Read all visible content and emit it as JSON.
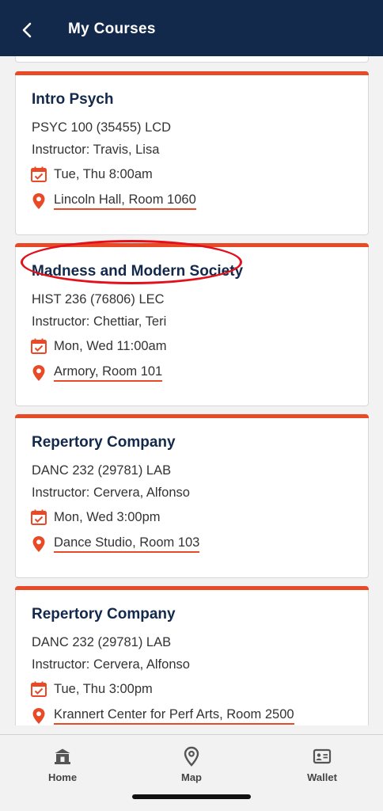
{
  "header": {
    "title": "My Courses"
  },
  "courses": [
    {
      "title": "Intro Psych",
      "code": "PSYC 100 (35455) LCD",
      "instructor": "Instructor: Travis, Lisa",
      "time": "Tue, Thu 8:00am",
      "location": "Lincoln Hall, Room 1060"
    },
    {
      "title": "Madness and Modern Society",
      "code": "HIST 236 (76806) LEC",
      "instructor": "Instructor: Chettiar, Teri",
      "time": "Mon, Wed 11:00am",
      "location": "Armory, Room 101"
    },
    {
      "title": "Repertory Company",
      "code": "DANC 232 (29781) LAB",
      "instructor": "Instructor: Cervera, Alfonso",
      "time": "Mon, Wed 3:00pm",
      "location": "Dance Studio, Room 103"
    },
    {
      "title": "Repertory Company",
      "code": "DANC 232 (29781) LAB",
      "instructor": "Instructor: Cervera, Alfonso",
      "time": "Tue, Thu 3:00pm",
      "location": "Krannert Center for Perf Arts, Room 2500"
    }
  ],
  "tabbar": {
    "home": "Home",
    "map": "Map",
    "wallet": "Wallet"
  },
  "colors": {
    "navy": "#13294b",
    "orange": "#e84a27",
    "highlight_red": "#e3101c"
  },
  "icons": {
    "back": "chevron-left-icon",
    "time": "calendar-check-icon",
    "location": "map-pin-icon",
    "home": "home-icon",
    "map": "map-pin-icon",
    "wallet": "id-card-icon"
  }
}
